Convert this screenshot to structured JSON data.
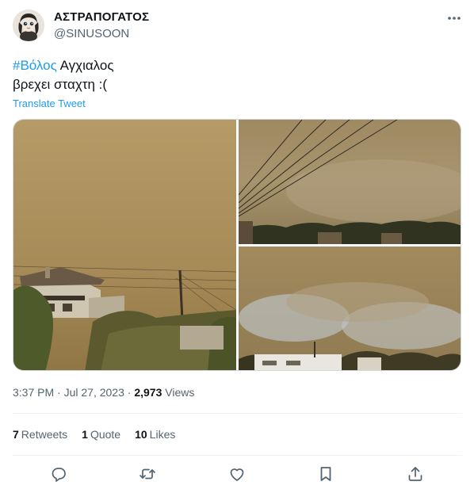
{
  "author": {
    "display_name": "ΑΣΤΡΑΠΟΓΑΤΟΣ",
    "handle": "@SINUSOON"
  },
  "tweet": {
    "hashtag": "#Βόλος",
    "line1_rest": " Αγχιαλος",
    "line2": "βρεχει σταχτη :(",
    "translate_label": "Translate Tweet"
  },
  "meta": {
    "time": "3:37 PM",
    "sep1": " · ",
    "date": "Jul 27, 2023",
    "sep2": " · ",
    "views_count": "2,973",
    "views_label": " Views"
  },
  "stats": {
    "retweets_count": "7",
    "retweets_label": "Retweets",
    "quotes_count": "1",
    "quotes_label": "Quote",
    "likes_count": "10",
    "likes_label": "Likes"
  },
  "icons": {
    "more": "more-horizontal-icon",
    "reply": "reply-icon",
    "retweet": "retweet-icon",
    "like": "like-icon",
    "bookmark": "bookmark-icon",
    "share": "share-icon"
  },
  "colors": {
    "accent": "#1d9bf0",
    "secondary_text": "#536471",
    "primary_text": "#0f1419",
    "smoke_sky": "#a58d5e"
  }
}
